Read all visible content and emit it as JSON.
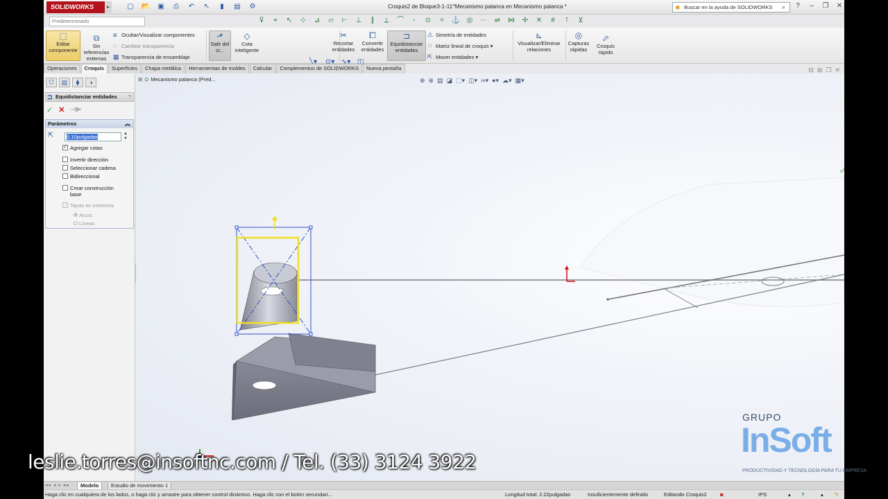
{
  "app": {
    "logo": "SOLIDWORKS",
    "document_title": "Croquis2 de Bloque3-1-11^Mecanismo palanca en Mecanismo palanca *",
    "help_search_placeholder": "Buscar en la ayuda de SOLIDWORKS",
    "configuration": "Predeterminado"
  },
  "ribbon": {
    "edit_component": "Editar componente",
    "no_external_refs": "Sin referencias externas",
    "hide_show_components": "Ocultar/Visualizar componentes",
    "change_transparency": "Cambiar transparencia",
    "assembly_transparency": "Transparencia de ensamblaje",
    "exit_sketch": "Salir del cr...",
    "smart_dimension": "Cota inteligente",
    "trim_entities": "Recortar entidades",
    "convert_entities": "Convertir entidades",
    "offset_entities": "Equidistanciar entidades",
    "mirror_entities": "Simetría de entidades",
    "linear_pattern": "Matriz lineal de croquis",
    "move_entities": "Mover entidades",
    "display_delete_relations": "Visualizar/Eliminar relaciones",
    "rapid_snaps": "Capturas rápidas",
    "rapid_sketch": "Croquis rápido"
  },
  "tabs": [
    "Operaciones",
    "Croquis",
    "Superficies",
    "Chapa metálica",
    "Herramientas de moldes",
    "Calcular",
    "Complementos de SOLIDWORKS",
    "Nueva pestaña"
  ],
  "active_tab": "Croquis",
  "property_manager": {
    "title": "Equidistanciar entidades",
    "help": "?",
    "group_title": "Parámetros",
    "distance_value": "0.10pulgadas",
    "add_dimensions": "Agregar cotas",
    "reverse": "Invertir dirección",
    "select_chain": "Seleccionar cadena",
    "bidirectional": "Bidireccional",
    "make_base_construction": "Crear construcción base",
    "cap_ends": "Tapas en extremos",
    "arcs": "Arcos",
    "lines": "Líneas"
  },
  "tree": {
    "root": "Mecanismo palanca  (Pred..."
  },
  "bottom_tabs": [
    "Modelo",
    "Estudio de movimiento 1"
  ],
  "active_bottom_tab": "Modelo",
  "status": {
    "message": "Haga clic en cualquiera de los lados, o haga clic y arrastre para obtener control dinámico. Haga clic con el botón secundari...",
    "total_length": "Longitud total: 2.22pulgadas",
    "definition": "Insuficientemente definido",
    "editing": "Editando Croquis2",
    "units": "IPS",
    "help": "?"
  },
  "overlay": {
    "contact": "leslie.torres@insoftnc.com / Tel. (33) 3124 3922",
    "watermark_group": "GRUPO",
    "watermark_brand": "InSoft",
    "watermark_tagline": "PRODUCTIVIDAD Y TECNOLOGÍA PARA TU EMPRESA"
  },
  "colors": {
    "logo_red": "#b3121c",
    "selection_blue": "#3a6fd8",
    "offset_yellow": "#f0e020",
    "sketch_blue": "#3050c8"
  },
  "icons": {
    "help_search": "lightbulb-icon",
    "ok": "check-icon",
    "cancel": "x-icon",
    "pin": "pin-icon"
  }
}
